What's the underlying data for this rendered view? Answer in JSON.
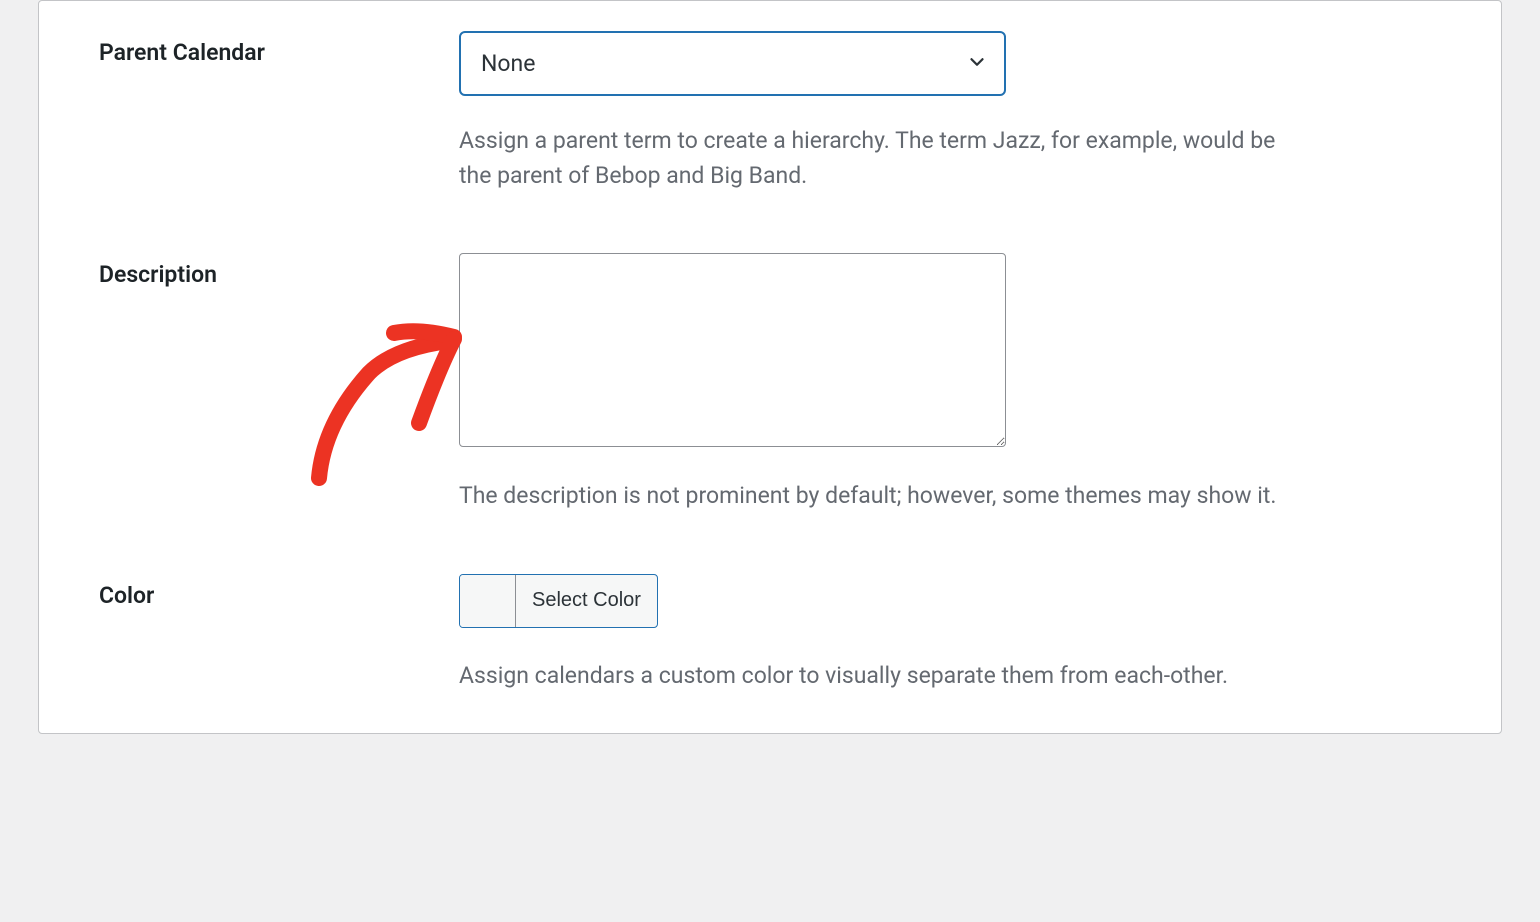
{
  "form": {
    "parent_calendar": {
      "label": "Parent Calendar",
      "selected_value": "None",
      "help_text": "Assign a parent term to create a hierarchy. The term Jazz, for example, would be the parent of Bebop and Big Band."
    },
    "description": {
      "label": "Description",
      "value": "",
      "help_text": "The description is not prominent by default; however, some themes may show it."
    },
    "color": {
      "label": "Color",
      "button_label": "Select Color",
      "help_text": "Assign calendars a custom color to visually separate them from each-other."
    }
  },
  "annotation": {
    "type": "arrow",
    "color": "#ec3323"
  }
}
